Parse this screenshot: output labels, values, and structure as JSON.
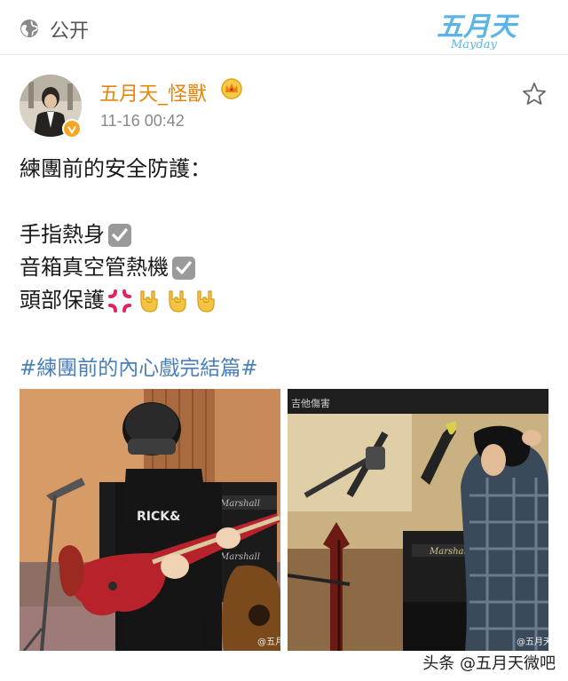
{
  "topbar": {
    "visibility_label": "公开",
    "icon": "globe-icon",
    "brand_logo_text": "五月天",
    "brand_logo_sub": "Mayday"
  },
  "post": {
    "author": "五月天_怪獸",
    "author_badge_icon": "crown-icon",
    "verified_icon": "verified-badge-icon",
    "time": "11-16 00:42",
    "favorite_icon": "star-icon",
    "lines": [
      "練團前的安全防護：",
      "",
      "手指熱身",
      "音箱真空管熱機",
      "頭部保護"
    ],
    "hashtag": "#練團前的內心戲完結篇#",
    "watermark_1": "@五月",
    "watermark_2": "@五月天",
    "photo2_caption": "吉他傷害"
  },
  "footer": {
    "source": "头条 @五月天微吧"
  },
  "colors": {
    "author": "#e8830c",
    "hashtag": "#4a7fb8",
    "meta": "#888888"
  }
}
